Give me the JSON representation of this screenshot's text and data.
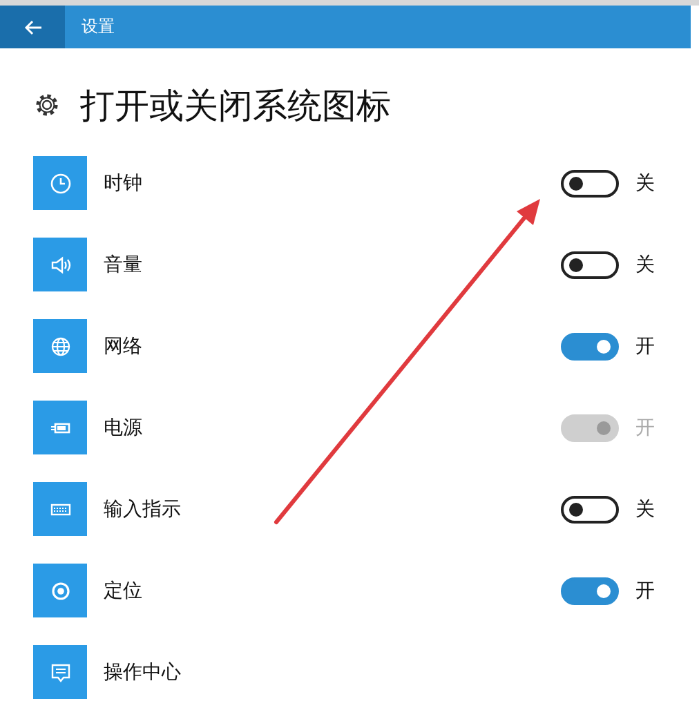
{
  "header": {
    "title": "设置"
  },
  "page": {
    "title": "打开或关闭系统图标"
  },
  "items": [
    {
      "label": "时钟",
      "on": false,
      "disabled": false,
      "state_text": "关"
    },
    {
      "label": "音量",
      "on": false,
      "disabled": false,
      "state_text": "关"
    },
    {
      "label": "网络",
      "on": true,
      "disabled": false,
      "state_text": "开"
    },
    {
      "label": "电源",
      "on": true,
      "disabled": true,
      "state_text": "开"
    },
    {
      "label": "输入指示",
      "on": false,
      "disabled": false,
      "state_text": "关"
    },
    {
      "label": "定位",
      "on": true,
      "disabled": false,
      "state_text": "开"
    },
    {
      "label": "操作中心"
    }
  ]
}
